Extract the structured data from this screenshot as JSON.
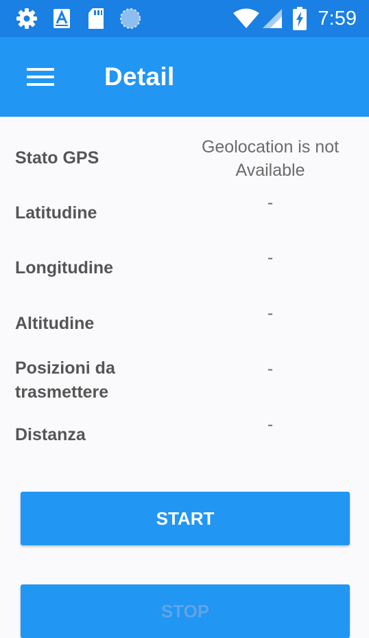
{
  "status_bar": {
    "time": "7:59",
    "icons": [
      "gear-icon",
      "font-a-icon",
      "sd-card-icon",
      "circle-icon",
      "wifi-icon",
      "signal-icon",
      "battery-charging-icon"
    ]
  },
  "app_bar": {
    "title": "Detail",
    "menu_icon": "hamburger-menu-icon"
  },
  "details": [
    {
      "label": "Stato GPS",
      "value": "Geolocation is not Available"
    },
    {
      "label": "Latitudine",
      "value": "-"
    },
    {
      "label": "Longitudine",
      "value": "-"
    },
    {
      "label": "Altitudine",
      "value": "-"
    },
    {
      "label": "Posizioni da trasmettere",
      "value": "-"
    },
    {
      "label": "Distanza",
      "value": "-"
    }
  ],
  "buttons": {
    "start_label": "START",
    "stop_label": "STOP"
  },
  "colors": {
    "status_bar": "#1a80e3",
    "app_bar": "#2196f3",
    "button": "#2196f3",
    "label_text": "#555555",
    "value_text": "#6b6b6b"
  }
}
